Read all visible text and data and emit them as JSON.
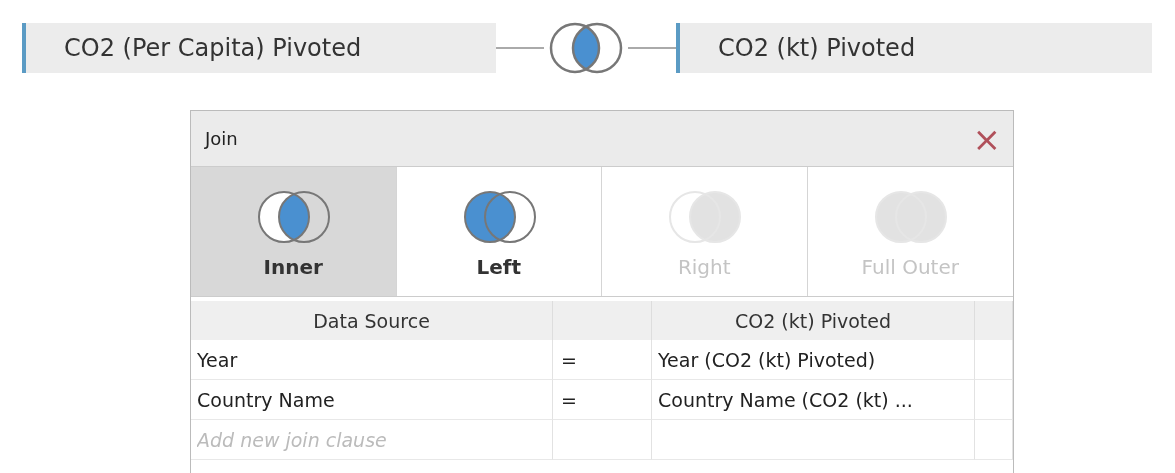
{
  "join_bar": {
    "left_table": "CO2 (Per Capita) Pivoted",
    "venn": {
      "left_filled": false,
      "overlap_filled": true,
      "right_filled": false
    },
    "right_table": "CO2 (kt) Pivoted"
  },
  "dialog": {
    "title": "Join",
    "close": "×",
    "join_types": [
      {
        "label": "Inner",
        "kind": "inner",
        "selected": true,
        "disabled": false
      },
      {
        "label": "Left",
        "kind": "left",
        "selected": false,
        "disabled": false
      },
      {
        "label": "Right",
        "kind": "right",
        "selected": false,
        "disabled": true
      },
      {
        "label": "Full Outer",
        "kind": "full",
        "selected": false,
        "disabled": true
      }
    ],
    "columns": [
      "Data Source",
      "CO2 (kt) Pivoted"
    ],
    "clauses": [
      {
        "left": "Year",
        "operator": "=",
        "right": "Year (CO2 (kt) Pivoted)"
      },
      {
        "left": "Country Name",
        "operator": "=",
        "right": "Country Name (CO2 (kt) ..."
      }
    ],
    "new_clause": {
      "placeholder": "Add new join clause"
    }
  }
}
